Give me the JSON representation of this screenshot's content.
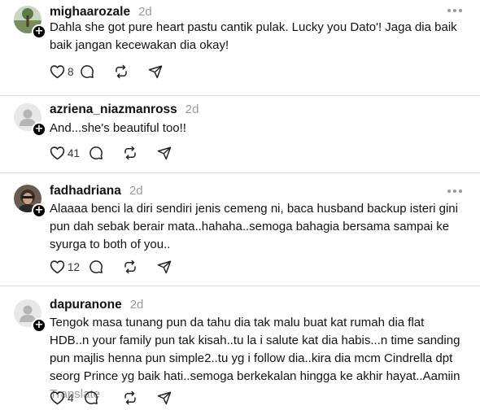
{
  "comments": [
    {
      "username": "mighaarozale",
      "age": "2d",
      "text": "Dahla she got pure heart pastu cantik pulak. Lucky you Dato'! Jaga dia baik baik jangan kecewakan dia okay!",
      "likes": "8",
      "avatar": "photo"
    },
    {
      "username": "azriena_niazmanross",
      "age": "2d",
      "text": "And...she's beautiful too!!",
      "likes": "41",
      "avatar": "default"
    },
    {
      "username": "fadhadriana",
      "age": "2d",
      "text": "Alaaaa benci la diri sendiri jenis cemeng ni, baca husband backup isteri gini pun dah sebak berair mata..hahaha..semoga bahagia bersama sampai ke syurga to both of you..",
      "likes": "12",
      "avatar": "photo"
    },
    {
      "username": "dapuranone",
      "age": "2d",
      "text": "Tengok masa tunang pun da tahu dia tak malu buat kat rumah dia flat HDB..n your family pun tak kisah..tu la i salute kat dia habis...n time sanding pun majlis henna pun simple2..tu yg i follow dia..kira dia mcm Cindrella dpt seorg Prince yg baik hati..semoga berkekalan hingga ke akhir hayat..Aamiin",
      "translate": "Translate",
      "likes": "4",
      "avatar": "default"
    }
  ],
  "icons": {
    "like": "heart-icon",
    "reply": "comment-icon",
    "repost": "repost-icon",
    "share": "send-icon",
    "more": "more-icon",
    "follow": "plus-icon"
  },
  "colors": {
    "text": "#111111",
    "muted": "#9a9a9a",
    "divider": "#dcdcdc"
  }
}
